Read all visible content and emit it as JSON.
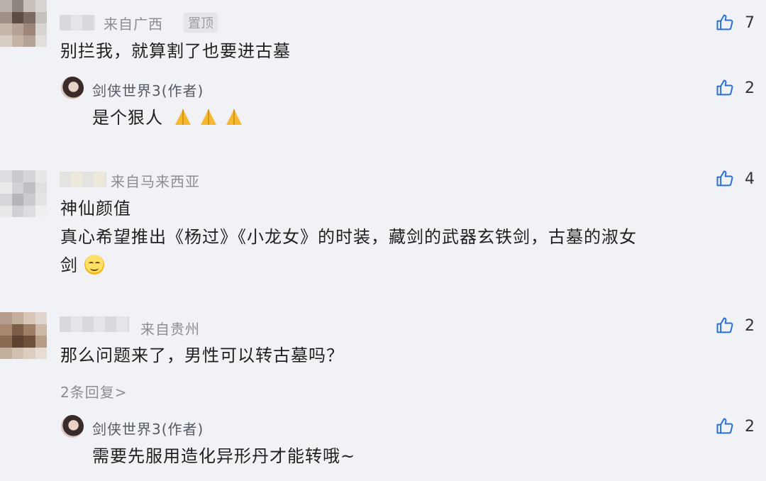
{
  "comments": [
    {
      "location": "来自广西",
      "pinned_label": "置顶",
      "text": "别拦我，就算割了也要进古墓",
      "likes": "7",
      "reply": {
        "author": "剑侠世界3(作者)",
        "text": "是个狠人",
        "likes": "2"
      }
    },
    {
      "location": "来自马来西亚",
      "text_line1": "神仙颜值",
      "text_line2": "真心希望推出《杨过》《小龙女》的时装，藏剑的武器玄铁剑，古墓的淑女",
      "text_line3": "剑",
      "likes": "4"
    },
    {
      "location": "来自贵州",
      "text": "那么问题来了，男性可以转古墓吗？",
      "likes": "2",
      "more_replies": "2条回复>",
      "reply": {
        "author": "剑侠世界3(作者)",
        "text": "需要先服用造化异形丹才能转哦~",
        "likes": "2"
      }
    }
  ],
  "icons": {
    "like": "thumbs-up-icon",
    "pray": "praying-hands-emoji",
    "smile": "smiling-face-emoji"
  },
  "colors": {
    "background": "#f1f2f5",
    "secondary_text": "#8a8d94",
    "like_icon": "#2a6fd6"
  }
}
